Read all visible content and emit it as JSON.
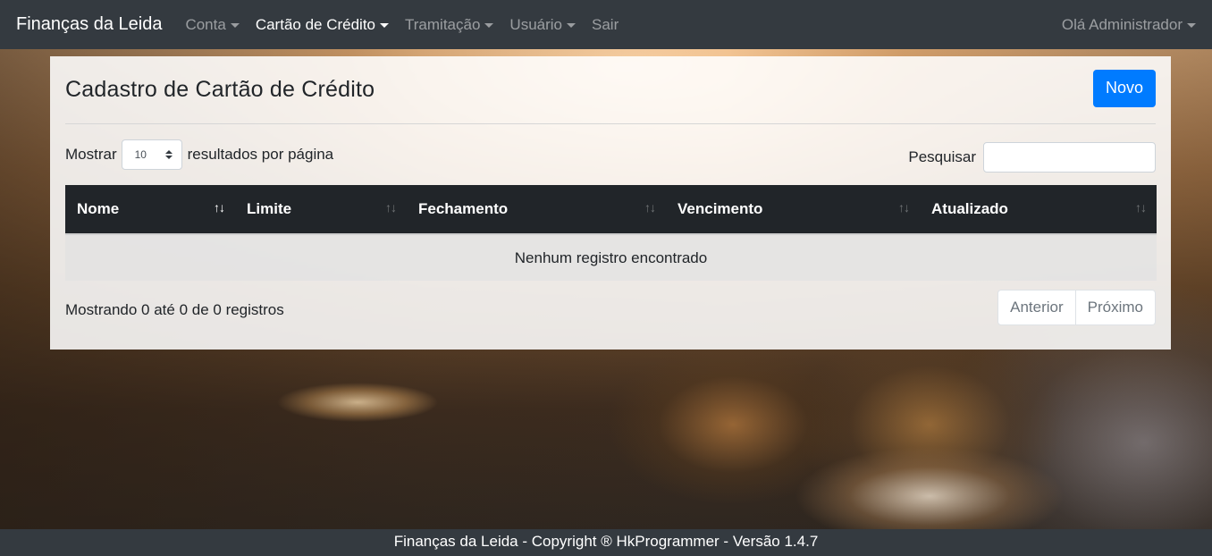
{
  "navbar": {
    "brand": "Finanças da Leida",
    "items": [
      {
        "label": "Conta",
        "dropdown": true,
        "active": false
      },
      {
        "label": "Cartão de Crédito",
        "dropdown": true,
        "active": true
      },
      {
        "label": "Tramitação",
        "dropdown": true,
        "active": false
      },
      {
        "label": "Usuário",
        "dropdown": true,
        "active": false
      },
      {
        "label": "Sair",
        "dropdown": false,
        "active": false
      }
    ],
    "user_greeting": "Olá Administrador"
  },
  "card": {
    "title": "Cadastro de Cartão de Crédito",
    "new_button": "Novo",
    "length_prefix": "Mostrar",
    "length_value": "10",
    "length_suffix": "resultados por página",
    "search_label": "Pesquisar",
    "search_value": "",
    "columns": [
      "Nome",
      "Limite",
      "Fechamento",
      "Vencimento",
      "Atualizado"
    ],
    "empty_message": "Nenhum registro encontrado",
    "info": "Mostrando 0 até 0 de 0 registros",
    "pager": {
      "previous": "Anterior",
      "next": "Próximo"
    }
  },
  "footer": {
    "text": "Finanças da Leida - Copyright ® HkProgrammer - Versão 1.4.7"
  },
  "colors": {
    "navbar_bg": "#343a40",
    "primary": "#007bff",
    "table_header_bg": "#212529"
  }
}
